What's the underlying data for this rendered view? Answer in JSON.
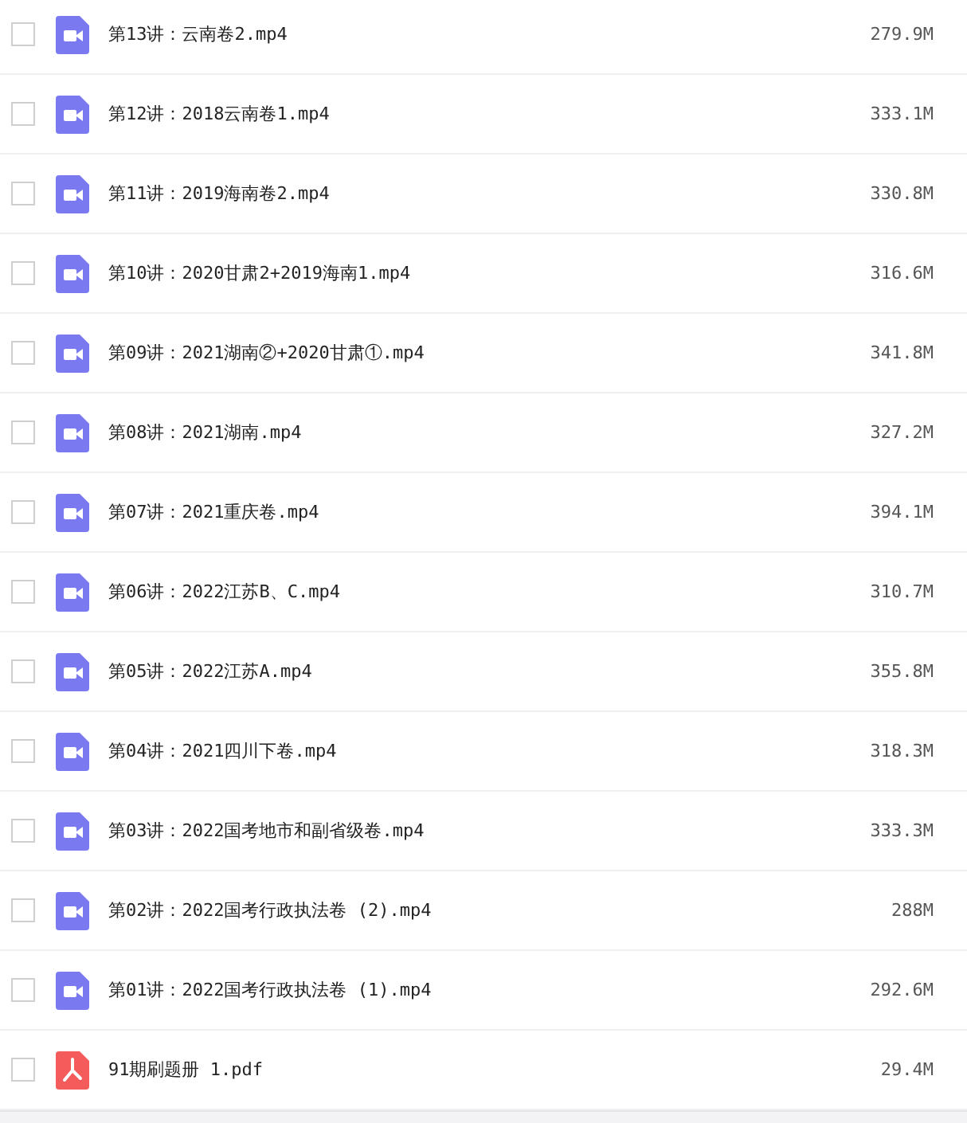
{
  "files": [
    {
      "kind": "video",
      "name": "第13讲：云南卷2.mp4",
      "size": "279.9M",
      "checked": false
    },
    {
      "kind": "video",
      "name": "第12讲：2018云南卷1.mp4",
      "size": "333.1M",
      "checked": false
    },
    {
      "kind": "video",
      "name": "第11讲：2019海南卷2.mp4",
      "size": "330.8M",
      "checked": false
    },
    {
      "kind": "video",
      "name": "第10讲：2020甘肃2+2019海南1.mp4",
      "size": "316.6M",
      "checked": false
    },
    {
      "kind": "video",
      "name": "第09讲：2021湖南②+2020甘肃①.mp4",
      "size": "341.8M",
      "checked": false
    },
    {
      "kind": "video",
      "name": "第08讲：2021湖南.mp4",
      "size": "327.2M",
      "checked": false
    },
    {
      "kind": "video",
      "name": "第07讲：2021重庆卷.mp4",
      "size": "394.1M",
      "checked": false
    },
    {
      "kind": "video",
      "name": "第06讲：2022江苏B、C.mp4",
      "size": "310.7M",
      "checked": false
    },
    {
      "kind": "video",
      "name": "第05讲：2022江苏A.mp4",
      "size": "355.8M",
      "checked": false
    },
    {
      "kind": "video",
      "name": "第04讲：2021四川下卷.mp4",
      "size": "318.3M",
      "checked": false
    },
    {
      "kind": "video",
      "name": "第03讲：2022国考地市和副省级卷.mp4",
      "size": "333.3M",
      "checked": false
    },
    {
      "kind": "video",
      "name": "第02讲：2022国考行政执法卷 (2).mp4",
      "size": "288M",
      "checked": false
    },
    {
      "kind": "video",
      "name": "第01讲：2022国考行政执法卷 (1).mp4",
      "size": "292.6M",
      "checked": false
    },
    {
      "kind": "pdf",
      "name": "91期刷题册 1.pdf",
      "size": "29.4M",
      "checked": false
    }
  ]
}
